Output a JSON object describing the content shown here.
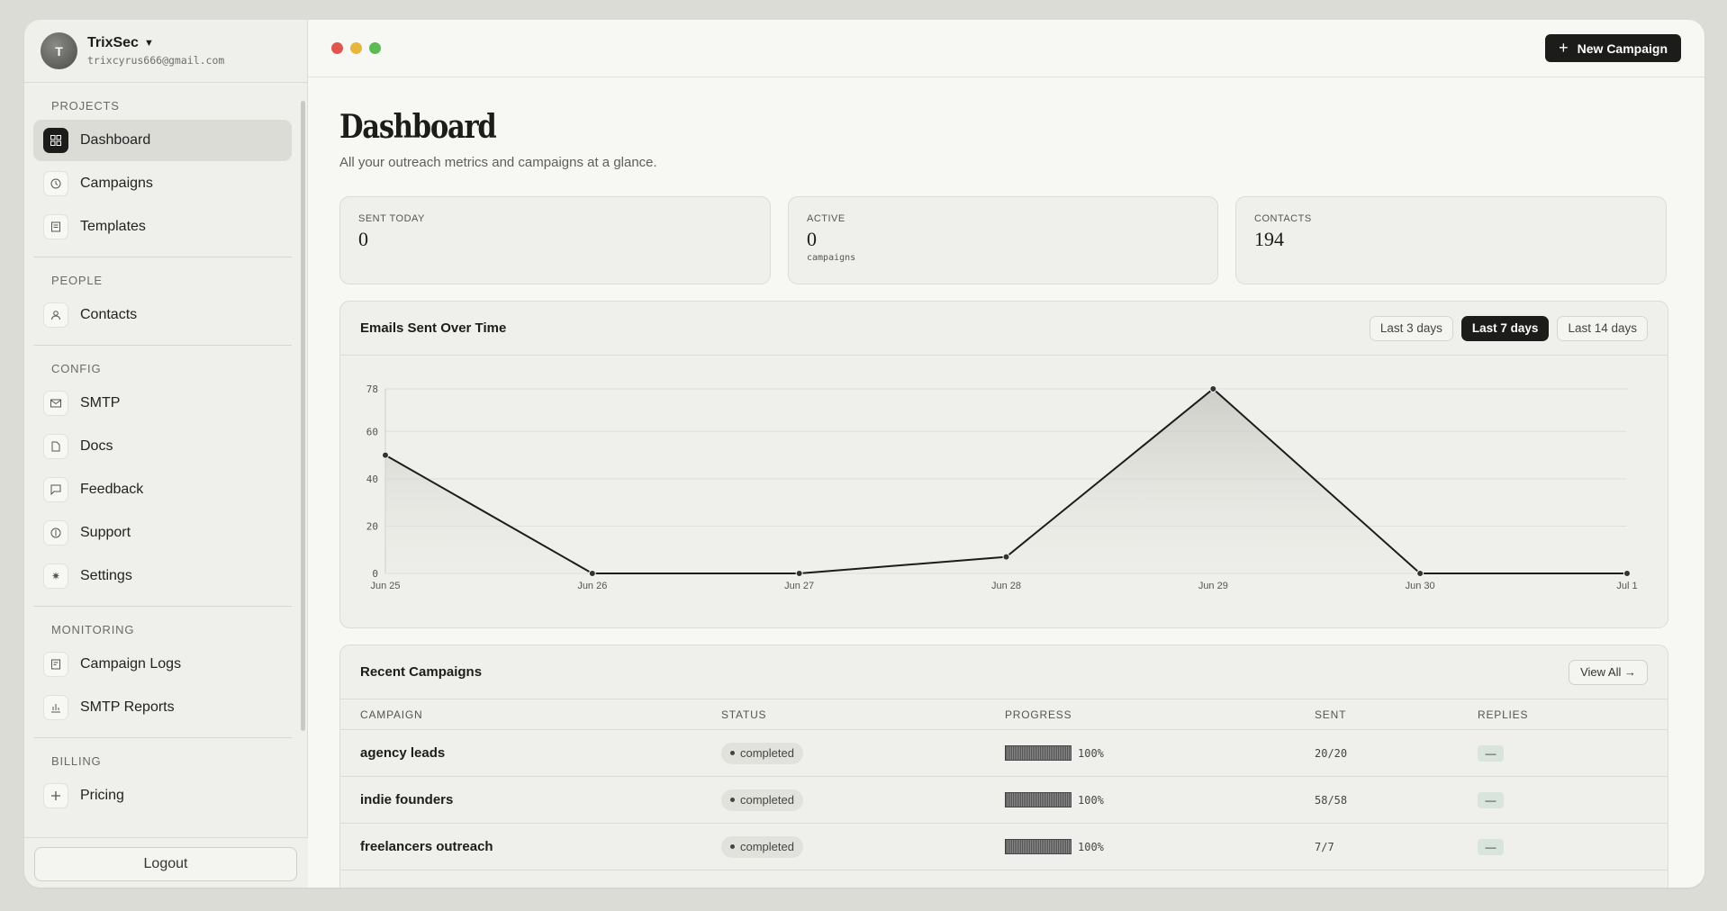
{
  "account": {
    "initial": "T",
    "name": "TrixSec",
    "email": "trixcyrus666@gmail.com"
  },
  "sidebar": {
    "sections": [
      {
        "label": "PROJECTS",
        "items": [
          {
            "label": "Dashboard",
            "icon": "grid-icon",
            "active": true
          },
          {
            "label": "Campaigns",
            "icon": "clock-icon"
          },
          {
            "label": "Templates",
            "icon": "document-icon"
          }
        ]
      },
      {
        "label": "PEOPLE",
        "items": [
          {
            "label": "Contacts",
            "icon": "user-icon"
          }
        ]
      },
      {
        "label": "CONFIG",
        "items": [
          {
            "label": "SMTP",
            "icon": "mail-icon"
          },
          {
            "label": "Docs",
            "icon": "file-icon"
          },
          {
            "label": "Feedback",
            "icon": "message-icon"
          },
          {
            "label": "Support",
            "icon": "support-icon"
          },
          {
            "label": "Settings",
            "icon": "gear-icon"
          }
        ]
      },
      {
        "label": "MONITORING",
        "items": [
          {
            "label": "Campaign Logs",
            "icon": "log-icon"
          },
          {
            "label": "SMTP Reports",
            "icon": "bar-chart-icon"
          }
        ]
      },
      {
        "label": "BILLING",
        "items": [
          {
            "label": "Pricing",
            "icon": "plus-icon"
          }
        ]
      }
    ],
    "logout_label": "Logout"
  },
  "topbar": {
    "new_campaign_label": "New Campaign"
  },
  "page": {
    "title": "Dashboard",
    "subtitle": "All your outreach metrics and campaigns at a glance."
  },
  "stats": [
    {
      "label": "SENT TODAY",
      "value": "0",
      "note": ""
    },
    {
      "label": "ACTIVE",
      "value": "0",
      "note": "campaigns"
    },
    {
      "label": "CONTACTS",
      "value": "194",
      "note": ""
    }
  ],
  "chart_panel": {
    "title": "Emails Sent Over Time",
    "ranges": [
      {
        "label": "Last 3 days"
      },
      {
        "label": "Last 7 days",
        "active": true
      },
      {
        "label": "Last 14 days"
      }
    ]
  },
  "chart_data": {
    "type": "area",
    "x": [
      "Jun 25",
      "Jun 26",
      "Jun 27",
      "Jun 28",
      "Jun 29",
      "Jun 30",
      "Jul 1"
    ],
    "values": [
      50,
      0,
      0,
      7,
      78,
      0,
      0
    ],
    "yticks": [
      0,
      20,
      40,
      60,
      78
    ],
    "ylim": [
      0,
      78
    ],
    "grid": true
  },
  "campaigns": {
    "title": "Recent Campaigns",
    "view_all_label": "View All →",
    "columns": [
      "CAMPAIGN",
      "STATUS",
      "PROGRESS",
      "SENT",
      "REPLIES"
    ],
    "rows": [
      {
        "name": "agency leads",
        "status": "completed",
        "progress": "100%",
        "sent": "20/20",
        "replies": "—"
      },
      {
        "name": "indie founders",
        "status": "completed",
        "progress": "100%",
        "sent": "58/58",
        "replies": "—"
      },
      {
        "name": "freelancers outreach",
        "status": "completed",
        "progress": "100%",
        "sent": "7/7",
        "replies": "—"
      }
    ]
  }
}
